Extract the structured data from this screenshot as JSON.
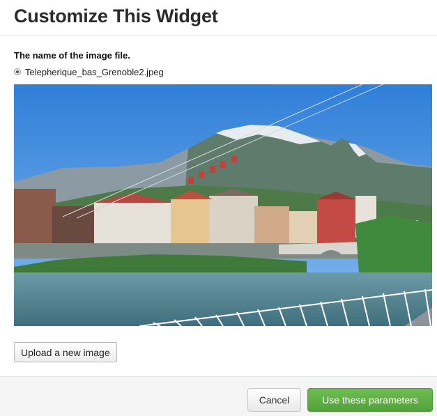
{
  "header": {
    "title": "Customize This Widget"
  },
  "field": {
    "label": "The name of the image file.",
    "selected_file": "Telepherique_bas_Grenoble2.jpeg"
  },
  "preview": {
    "alt": "Telepherique_bas_Grenoble2.jpeg"
  },
  "actions": {
    "upload_label": "Upload a new image",
    "cancel_label": "Cancel",
    "submit_label": "Use these parameters"
  },
  "colors": {
    "primary_button": "#5cb246",
    "footer_bg": "#f5f5f5"
  }
}
